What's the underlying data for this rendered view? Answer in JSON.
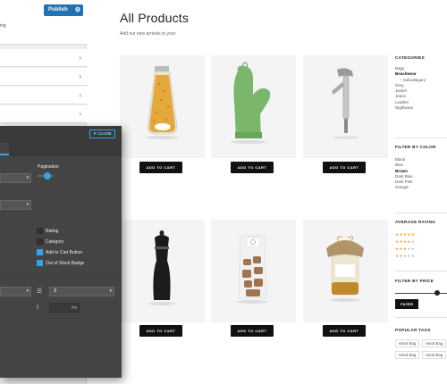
{
  "customizer": {
    "publish_label": "Publish",
    "note": "ing"
  },
  "page": {
    "title": "All Products",
    "subtitle": "Add our new arrivals to your"
  },
  "products": [
    {
      "name": "pasta-jar",
      "cart_label": "ADD TO CART"
    },
    {
      "name": "oven-mitt",
      "cart_label": "ADD TO CART"
    },
    {
      "name": "corkscrew",
      "cart_label": "ADD TO CART"
    },
    {
      "name": "pepper-mill",
      "cart_label": "ADD TO CART"
    },
    {
      "name": "cookie-bag",
      "cart_label": "ADD TO CART"
    },
    {
      "name": "honey-jar",
      "cart_label": "ADD TO CART"
    }
  ],
  "sidebar": {
    "categories": {
      "title": "CATEGORIES",
      "items": [
        "Bags",
        "Beachwear",
        "– Subcategory",
        "Grey",
        "Jacket",
        "Jeans",
        "Leather",
        "Nightwear"
      ]
    },
    "colors": {
      "title": "FILTER BY COLOR",
      "items": [
        "Black",
        "Blue",
        "Brown",
        "Dark Blue",
        "Dark Pink",
        "Orange"
      ]
    },
    "rating": {
      "title": "AVERAGE RATING",
      "levels": [
        5,
        4,
        3,
        2
      ]
    },
    "price": {
      "title": "FILTER BY PRICE",
      "filter_label": "FILTER"
    },
    "tags": {
      "title": "POPULAR TAGS",
      "items": [
        "Hand Bag",
        "Hand Bag",
        "Hand Bag",
        "Hand Bag"
      ]
    }
  },
  "panel": {
    "close_label": "✕ CLOSE",
    "pagination_label": "Pagination",
    "pagination_value": 0.6,
    "options": [
      {
        "label": "Rating",
        "checked": false
      },
      {
        "label": "Category",
        "checked": false
      },
      {
        "label": "Add to Cart Button",
        "checked": true
      },
      {
        "label": "Out of Stock Badge",
        "checked": true
      }
    ],
    "columns_value": "3",
    "px_unit": "PX"
  },
  "colors": {
    "accent": "#2ea6e8",
    "publish": "#2271b1",
    "panel_bg": "#444444"
  }
}
